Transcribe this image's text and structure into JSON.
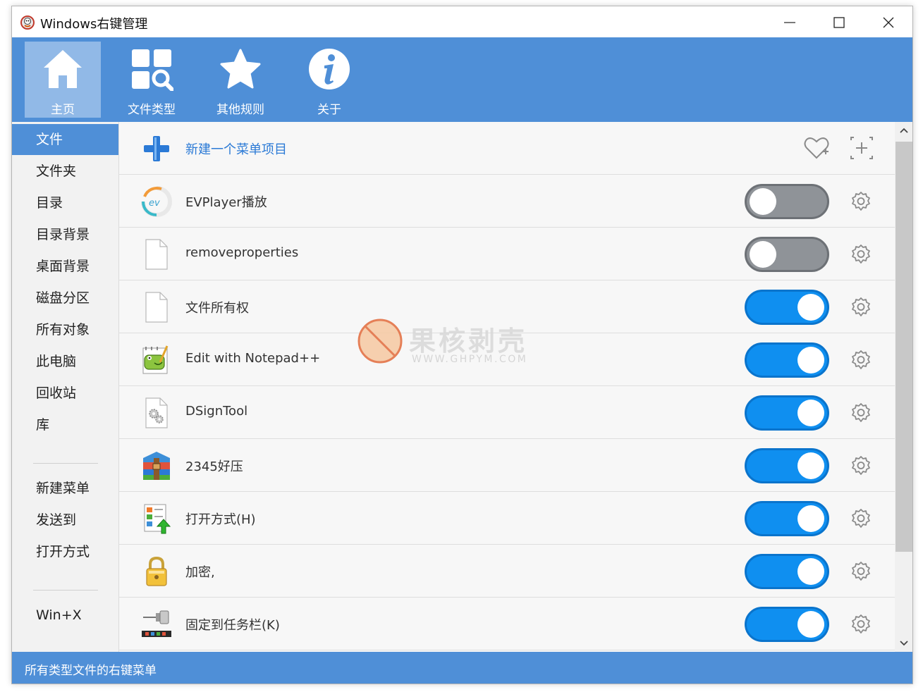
{
  "window": {
    "title": "Windows右键管理"
  },
  "toolbar": {
    "items": [
      {
        "label": "主页",
        "icon": "home-icon",
        "active": true
      },
      {
        "label": "文件类型",
        "icon": "file-types-icon"
      },
      {
        "label": "其他规则",
        "icon": "star-icon"
      },
      {
        "label": "关于",
        "icon": "info-icon"
      }
    ]
  },
  "sidebar": {
    "items": [
      {
        "label": "文件",
        "active": true
      },
      {
        "label": "文件夹"
      },
      {
        "label": "目录"
      },
      {
        "label": "目录背景"
      },
      {
        "label": "桌面背景"
      },
      {
        "label": "磁盘分区"
      },
      {
        "label": "所有对象"
      },
      {
        "label": "此电脑"
      },
      {
        "label": "回收站"
      },
      {
        "label": "库"
      }
    ],
    "items2": [
      {
        "label": "新建菜单"
      },
      {
        "label": "发送到"
      },
      {
        "label": "打开方式"
      }
    ],
    "items3": [
      {
        "label": "Win+X"
      }
    ]
  },
  "content": {
    "new_item_label": "新建一个菜单项目",
    "rows": [
      {
        "label": "EVPlayer播放",
        "icon": "evplayer-icon",
        "enabled": false
      },
      {
        "label": "removeproperties",
        "icon": "blank-file-icon",
        "enabled": false
      },
      {
        "label": "文件所有权",
        "icon": "blank-file-icon",
        "enabled": true
      },
      {
        "label": "Edit with Notepad++",
        "icon": "notepadpp-icon",
        "enabled": true
      },
      {
        "label": "DSignTool",
        "icon": "gear-file-icon",
        "enabled": true
      },
      {
        "label": "2345好压",
        "icon": "archive-icon",
        "enabled": true
      },
      {
        "label": "打开方式(H)",
        "icon": "open-with-icon",
        "enabled": true
      },
      {
        "label": "加密,",
        "icon": "lock-icon",
        "enabled": true
      },
      {
        "label": "固定到任务栏(K)",
        "icon": "pin-taskbar-icon",
        "enabled": true
      }
    ]
  },
  "statusbar": {
    "text": "所有类型文件的右键菜单"
  },
  "watermark": {
    "cn": "果核剥壳",
    "en": "WWW.GHPYM.COM"
  },
  "colors": {
    "accent": "#4f8fd7",
    "toggle_on": "#0f8ff0",
    "toggle_off": "#8f9398"
  }
}
